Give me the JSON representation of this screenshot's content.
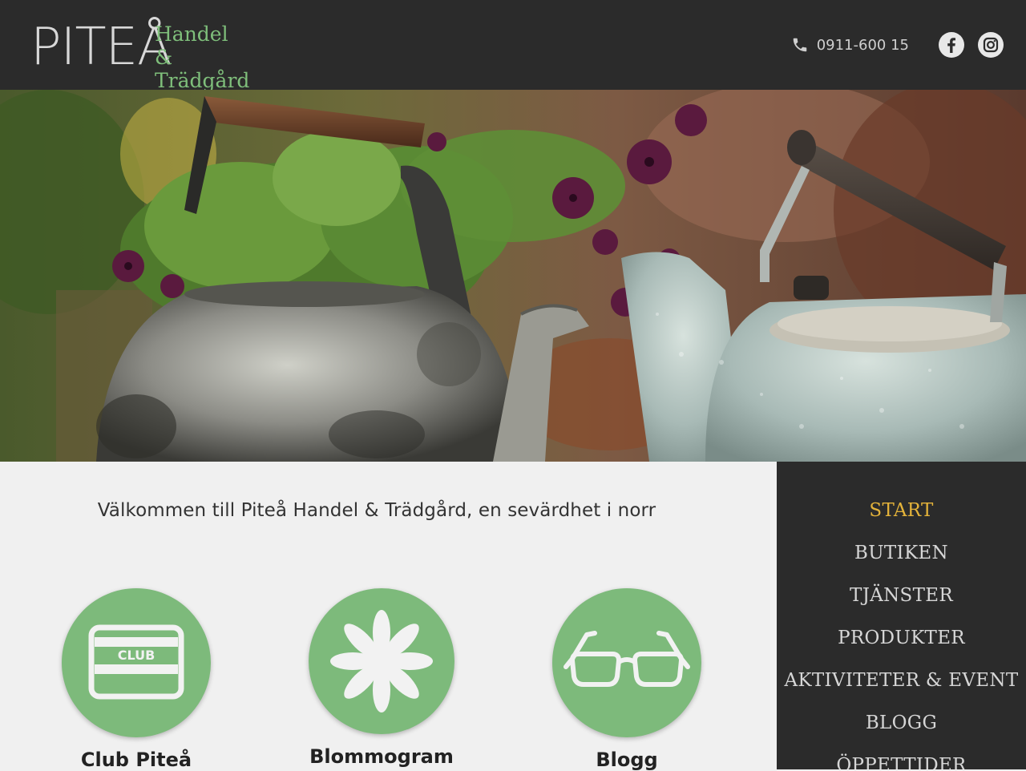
{
  "header": {
    "logo_main": "PITEÅ",
    "logo_sub_line1": "Handel &",
    "logo_sub_line2": "Trädgård",
    "phone": "0911-600 15",
    "icons": [
      "phone-icon",
      "facebook-icon",
      "instagram-icon"
    ]
  },
  "hero": {
    "image": "Two old enamel kettles with flowers"
  },
  "main": {
    "welcome": "Välkommen till Piteå Handel & Trädgård, en sevärdhet i norr",
    "features": [
      {
        "title": "Club Piteå",
        "icon": "club-card-icon",
        "icon_text": "CLUB"
      },
      {
        "title": "Blommogram",
        "icon": "flower-icon"
      },
      {
        "title": "Blogg",
        "icon": "glasses-icon"
      }
    ]
  },
  "nav": {
    "items": [
      "START",
      "BUTIKEN",
      "TJÄNSTER",
      "PRODUKTER",
      "AKTIVITETER & EVENT",
      "BLOGG",
      "ÖPPETTIDER"
    ],
    "active": "START"
  },
  "colors": {
    "header_bg": "#2b2b2b",
    "accent_green": "#7dba7b",
    "nav_active": "#e4b33a",
    "page_bg": "#f0f0f0"
  }
}
